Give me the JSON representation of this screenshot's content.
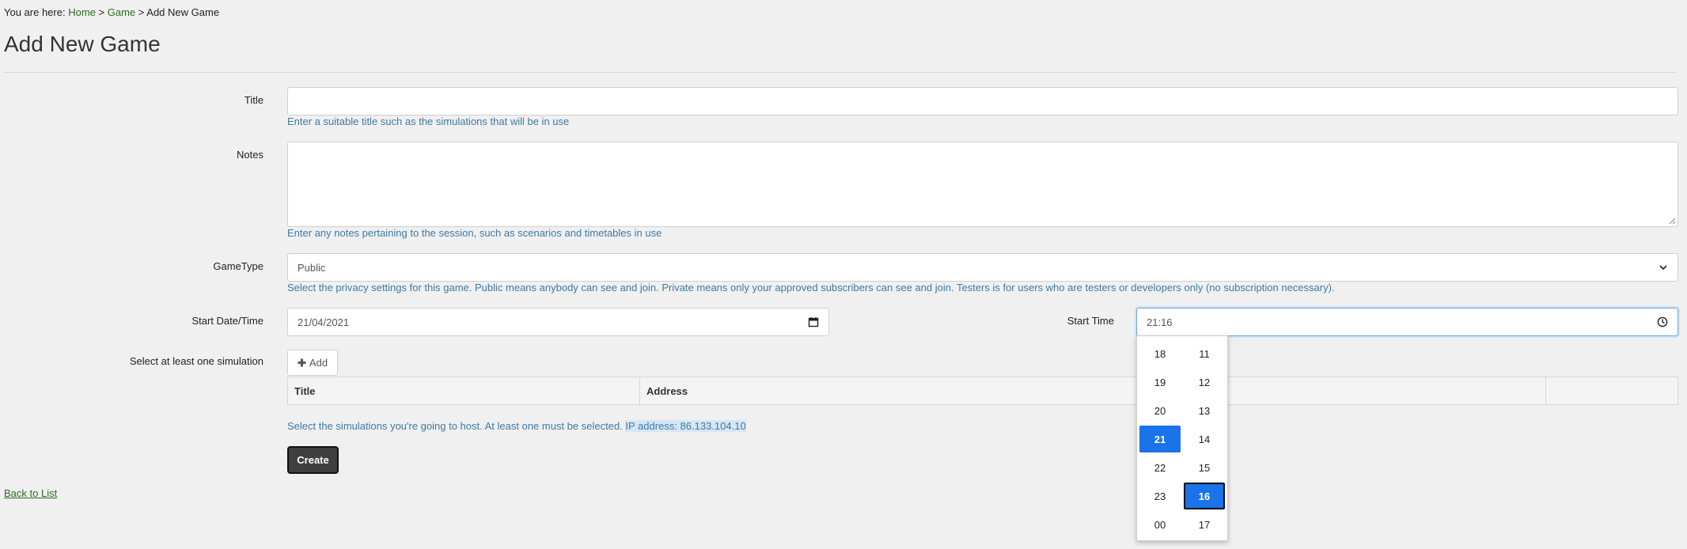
{
  "breadcrumb": {
    "prefix": "You are here:",
    "home": "Home",
    "sep1": ">",
    "game": "Game",
    "sep2": ">",
    "current": "Add New Game"
  },
  "page_title": "Add New Game",
  "form": {
    "title": {
      "label": "Title",
      "value": "",
      "help": "Enter a suitable title such as the simulations that will be in use"
    },
    "notes": {
      "label": "Notes",
      "value": "",
      "help": "Enter any notes pertaining to the session, such as scenarios and timetables in use"
    },
    "gametype": {
      "label": "GameType",
      "value": "Public",
      "help": "Select the privacy settings for this game. Public means anybody can see and join. Private means only your approved subscribers can see and join. Testers is for users who are testers or developers only (no subscription necessary)."
    },
    "start_date": {
      "label": "Start Date/Time",
      "value": "21/04/2021"
    },
    "start_time": {
      "label": "Start Time",
      "value": "21:16"
    },
    "simulation": {
      "label": "Select at least one simulation",
      "add_label": "Add",
      "columns": [
        "Title",
        "Address",
        ""
      ],
      "help": "Select the simulations you're going to host. At least one must be selected.",
      "ip": "IP address: 86.133.104.10"
    },
    "create_label": "Create"
  },
  "back_link": "Back to List",
  "time_picker": {
    "hours": [
      "18",
      "19",
      "20",
      "21",
      "22",
      "23",
      "00"
    ],
    "minutes": [
      "11",
      "12",
      "13",
      "14",
      "15",
      "16",
      "17"
    ],
    "selected_hour": "21",
    "selected_minute": "16"
  },
  "colors": {
    "accent": "#1a73e8",
    "link": "#2b6e1f",
    "help": "#3f7aa5",
    "button_dark": "#3f3f3f"
  },
  "icons": {
    "calendar": "calendar-icon",
    "clock": "clock-icon",
    "plus": "plus-icon",
    "chevron": "chevron-down-icon"
  }
}
